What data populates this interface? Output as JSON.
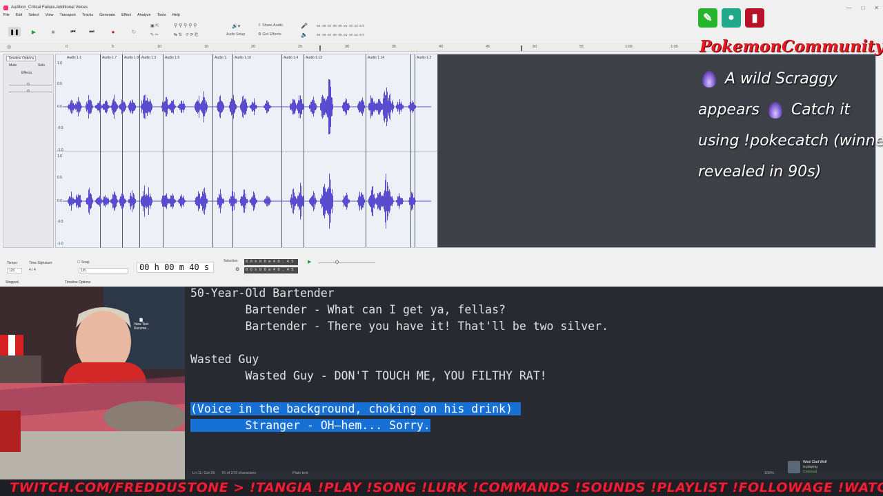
{
  "audition": {
    "title": "Audition_Critical Failure-Additional Voices",
    "menu": [
      "File",
      "Edit",
      "Select",
      "View",
      "Transport",
      "Tracks",
      "Generate",
      "Effect",
      "Analyze",
      "Tools",
      "Help"
    ],
    "toolbar": {
      "audio_setup": "Audio Setup",
      "share_audio": "Share Audio",
      "get_effects": "Get Effects",
      "meter_ticks": "-54 -48 -42 -36 -30 -24 -18 -12 -6 0"
    },
    "ruler_ticks": [
      "0",
      "5",
      "10",
      "15",
      "20",
      "25",
      "30",
      "35",
      "40",
      "45",
      "50",
      "55",
      "1:00",
      "1:05"
    ],
    "track_header": {
      "timeline_options": "Timeline Options",
      "mute": "Mute",
      "solo": "Solo",
      "effects": "Effects"
    },
    "y_axis": [
      "1.0",
      "0.5",
      "0.0",
      "-0.5",
      "-1.0",
      "1.0",
      "0.5",
      "0.0",
      "-0.5",
      "-1.0"
    ],
    "clips": [
      "Audio 1.1",
      "Audio 1.7",
      "Audio 1.9",
      "Audio 1.3",
      "Audio 1.5",
      "Audio 1.",
      "Audio 1.10",
      "Audio 1.4",
      "Audio 1.13",
      "Audio 1.14",
      "Audio 1.2"
    ],
    "bottom": {
      "tempo_label": "Tempo",
      "tempo_value": "120",
      "time_sig_label": "Time Signature",
      "time_sig_value": "4   /   4",
      "snap_label": "Snap",
      "snap_value": "1/8",
      "timecode": "00 h 00 m 40 s",
      "selection_label": "Selection",
      "selection_start": "0 0 h 0 0 m 4 0 . 4 5 0 s",
      "selection_end": "0 0 h 0 0 m 4 0 . 4 5 0 s"
    },
    "status_left": "Stopped.",
    "status_mid": "Timeline Options"
  },
  "overlay": {
    "channel_name": "PokemonCommunityGame",
    "message_lines": [
      "A wild Scraggy",
      "appears",
      "Catch it",
      "using !pokecatch (winners",
      "revealed in 90s)"
    ],
    "icon_colors": [
      "#27b52e",
      "#22a88a",
      "#b8122a"
    ]
  },
  "doc": {
    "lines": [
      "50-Year-Old Bartender",
      "        Bartender - What can I get ya, fellas?",
      "        Bartender - There you have it! That'll be two silver.",
      "",
      "Wasted Guy",
      "        Wasted Guy - DON'T TOUCH ME, YOU FILTHY RAT!",
      "",
      "(Voice in the background, choking on his drink)",
      "        Stranger - OH—hem... Sorry."
    ],
    "status_pos": "Ln 11, Col 29",
    "status_chars": "76 of 273 characters",
    "status_type": "Plain text",
    "zoom": "100%"
  },
  "webcam": {
    "desktop_icon_label": "New Text Docume..."
  },
  "notification": {
    "name": "Wool Clad Wolf",
    "line2": "is playing",
    "line3": "Crossout"
  },
  "ticker": {
    "text": "TWITCH.COM/FREDDUSTONE > !TANGIA !PLAY !SONG !LURK !COMMANDS !SOUNDS !PLAYLIST !FOLLOWAGE !WATCHTIME !SOCIALS !SOUNDS!"
  }
}
